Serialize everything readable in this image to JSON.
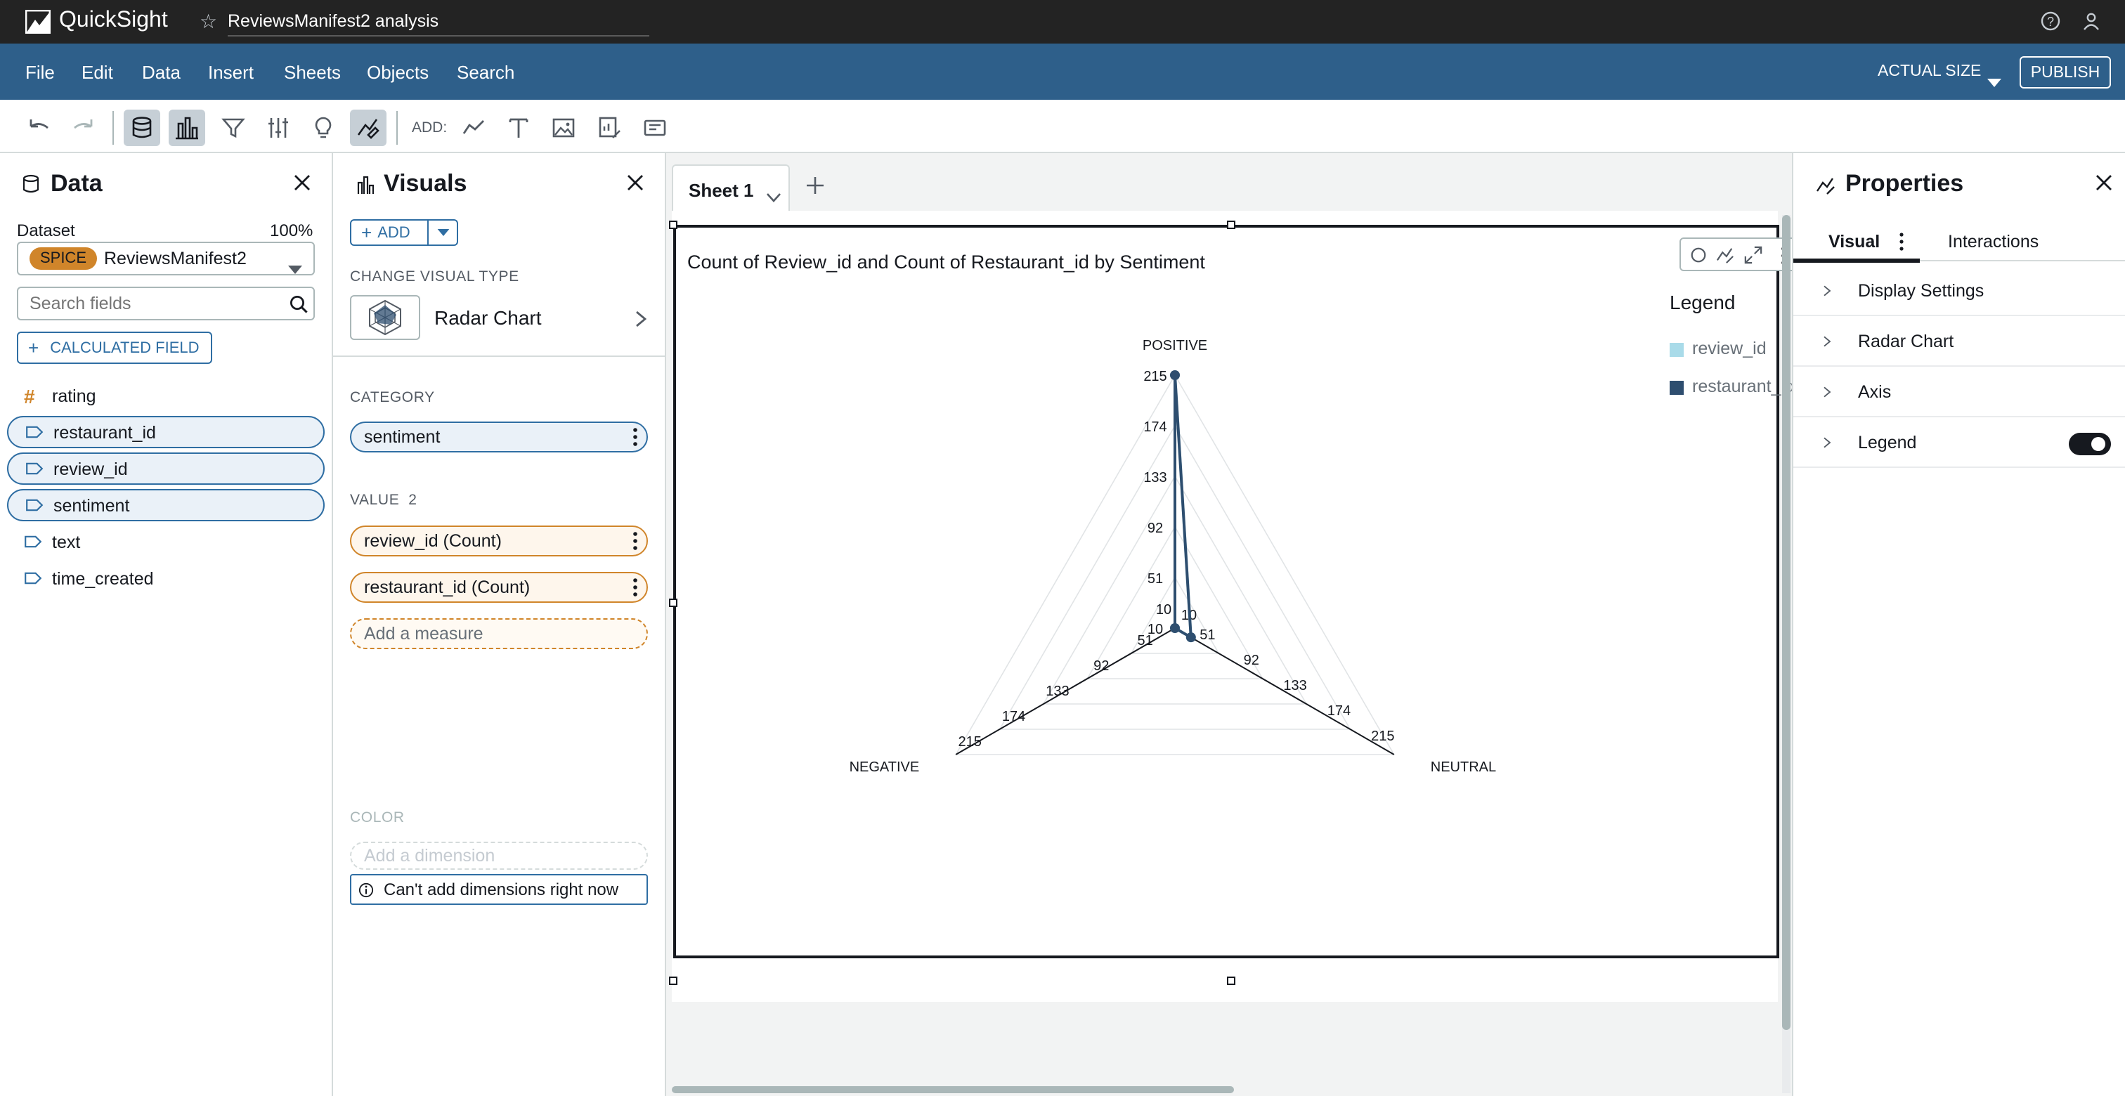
{
  "app": {
    "name": "QuickSight",
    "analysis_title": "ReviewsManifest2 analysis"
  },
  "menu": [
    "File",
    "Edit",
    "Data",
    "Insert",
    "Sheets",
    "Objects",
    "Search"
  ],
  "topright": {
    "zoom_label": "ACTUAL SIZE",
    "publish_label": "PUBLISH"
  },
  "toolbar": {
    "add_label": "ADD:"
  },
  "data_panel": {
    "title": "Data",
    "dataset_label": "Dataset",
    "dataset_percent": "100%",
    "spice_badge": "SPICE",
    "dataset_name": "ReviewsManifest2",
    "search_placeholder": "Search fields",
    "calc_field_label": "CALCULATED FIELD",
    "fields": [
      {
        "name": "rating",
        "type": "number",
        "selected": false
      },
      {
        "name": "restaurant_id",
        "type": "dimension",
        "selected": true
      },
      {
        "name": "review_id",
        "type": "dimension",
        "selected": true
      },
      {
        "name": "sentiment",
        "type": "dimension",
        "selected": true
      },
      {
        "name": "text",
        "type": "dimension",
        "selected": false
      },
      {
        "name": "time_created",
        "type": "dimension",
        "selected": false
      }
    ]
  },
  "visuals_panel": {
    "title": "Visuals",
    "add_label": "ADD",
    "change_type_label": "CHANGE VISUAL TYPE",
    "visual_type": "Radar Chart",
    "category_label": "CATEGORY",
    "category_field": "sentiment",
    "value_label": "VALUE",
    "value_count": "2",
    "value_fields": [
      "review_id (Count)",
      "restaurant_id (Count)"
    ],
    "add_measure": "Add a measure",
    "color_label": "COLOR",
    "add_dimension": "Add a dimension",
    "cant_add": "Can't add dimensions right now"
  },
  "sheet": {
    "tab_label": "Sheet 1"
  },
  "visual": {
    "title": "Count of Review_id and Count of Restaurant_id by Sentiment"
  },
  "props_panel": {
    "title": "Properties",
    "tabs": [
      "Visual",
      "Interactions"
    ],
    "sections": [
      "Display Settings",
      "Radar Chart",
      "Axis",
      "Legend"
    ],
    "legend_toggle_on": true
  },
  "colors": {
    "brand_bar": "#2e5f8a",
    "series_review_id": "#a9dbe9",
    "series_restaurant_id": "#2e4e6f",
    "spice_badge": "#d0852a"
  },
  "chart_data": {
    "type": "radar",
    "title": "Count of Review_id and Count of Restaurant_id by Sentiment",
    "categories": [
      "POSITIVE",
      "NEUTRAL",
      "NEGATIVE"
    ],
    "ticks": [
      10,
      51,
      92,
      133,
      174,
      215
    ],
    "range": [
      10,
      215
    ],
    "legend_title": "Legend",
    "legend_position": "top-right",
    "series": [
      {
        "name": "review_id",
        "color": "#a9dbe9",
        "values": [
          215,
          25,
          10
        ]
      },
      {
        "name": "restaurant_id",
        "color": "#2e4e6f",
        "values": [
          215,
          25,
          10
        ]
      }
    ]
  }
}
